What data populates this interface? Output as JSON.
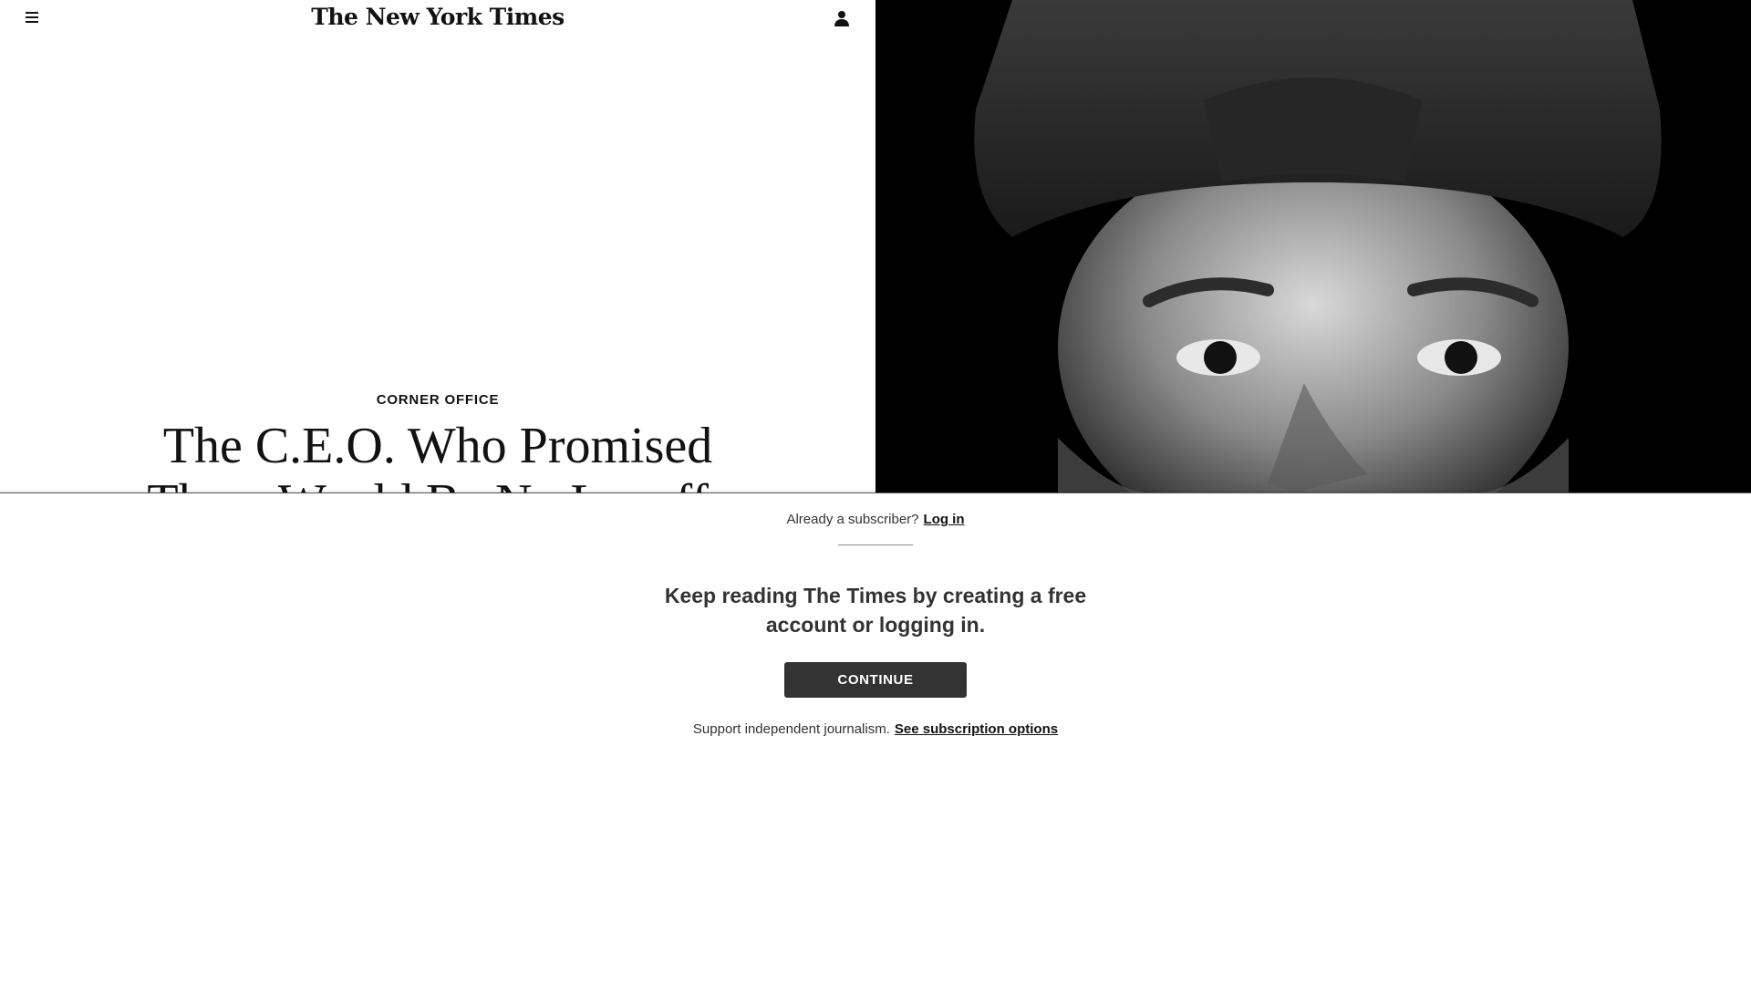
{
  "header": {
    "menu_icon": "hamburger-menu-icon",
    "logo_text": "The New York Times",
    "account_icon": "person-icon"
  },
  "article": {
    "kicker": "CORNER OFFICE",
    "headline": "The C.E.O. Who Promised There Would Be No Layoffs"
  },
  "photo": {
    "alt": "Portrait of a man wearing a dark turban"
  },
  "paywall": {
    "already_text": "Already a subscriber?",
    "login_link": "Log in",
    "keep_reading": "Keep reading The Times by creating a free account or logging in.",
    "continue_label": "CONTINUE",
    "support_text": "Support independent journalism.",
    "subscription_link": "See subscription options"
  },
  "colors": {
    "text": "#121212",
    "button_bg": "#333333",
    "photo_bg": "#000000"
  }
}
